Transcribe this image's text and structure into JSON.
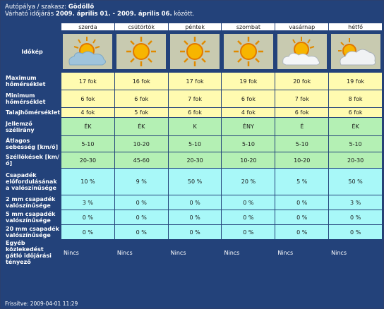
{
  "header": {
    "line1_prefix": "Autópálya / szakasz:",
    "location": "Gödöllő",
    "line2_prefix": "Várható időjárás",
    "period": "2009. április 01. - 2009. április 06.",
    "line2_suffix": "között."
  },
  "days": [
    "szerda",
    "csütörtök",
    "péntek",
    "szombat",
    "vasárnap",
    "hétfő"
  ],
  "icons_label": "Időkép",
  "icons": [
    "partly-cloudy-icon",
    "sun-icon",
    "sun-icon",
    "sun-icon",
    "partly-cloudy-icon",
    "partly-cloudy-icon"
  ],
  "rows": [
    {
      "label": "Maximum hőmérséklet",
      "values": [
        "17 fok",
        "16 fok",
        "17 fok",
        "19 fok",
        "20 fok",
        "19 fok"
      ]
    },
    {
      "label": "Minimum hőmérséklet",
      "values": [
        "6 fok",
        "6 fok",
        "7 fok",
        "6 fok",
        "7 fok",
        "8 fok"
      ]
    },
    {
      "label": "Talajhőmérséklet",
      "values": [
        "4 fok",
        "5 fok",
        "6 fok",
        "4 fok",
        "6 fok",
        "6 fok"
      ]
    },
    {
      "label": "Jellemző szélirány",
      "values": [
        "ÉK",
        "ÉK",
        "K",
        "ÉNY",
        "É",
        "ÉK"
      ]
    },
    {
      "label": "Átlagos sebesség [km/ó]",
      "values": [
        "5-10",
        "10-20",
        "5-10",
        "5-10",
        "5-10",
        "5-10"
      ]
    },
    {
      "label": "Széllökések [km/ó]",
      "values": [
        "20-30",
        "45-60",
        "20-30",
        "10-20",
        "10-20",
        "20-30"
      ]
    },
    {
      "label": "Csapadék előfordulásának a valószínűsége",
      "values": [
        "10 %",
        "9 %",
        "50 %",
        "20 %",
        "5 %",
        "50 %"
      ]
    },
    {
      "label": "2 mm csapadék valószínűsége",
      "values": [
        "3 %",
        "0 %",
        "0 %",
        "0 %",
        "0 %",
        "3 %"
      ]
    },
    {
      "label": "5 mm csapadék valószínűsége",
      "values": [
        "0 %",
        "0 %",
        "0 %",
        "0 %",
        "0 %",
        "0 %"
      ]
    },
    {
      "label": "20 mm csapadék valószínűsége",
      "values": [
        "0 %",
        "0 %",
        "0 %",
        "0 %",
        "0 %",
        "0 %"
      ]
    },
    {
      "label": "Egyéb közlekedést gátló időjárási tényező",
      "values": [
        "Nincs",
        "Nincs",
        "Nincs",
        "Nincs",
        "Nincs",
        "Nincs"
      ]
    }
  ],
  "footer": "Frissítve: 2009-04-01 11:29",
  "colors": {
    "navy": "#23427a",
    "yellow": "#fffbb0",
    "green": "#b4f0b4",
    "cyan": "#a8f8f8",
    "icon_bg": "#c8cab0"
  }
}
